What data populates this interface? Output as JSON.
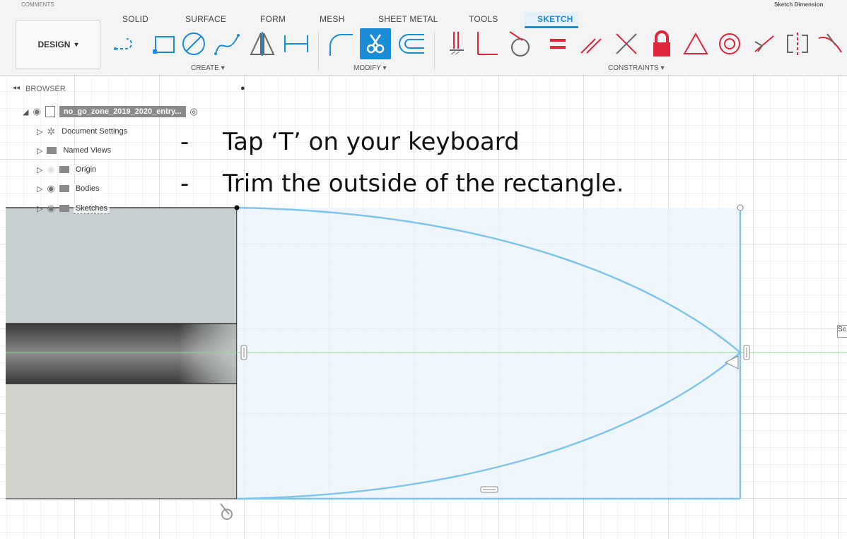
{
  "header": {
    "comments_label": "COMMENTS",
    "sketch_dimension_label": "Sketch Dimension"
  },
  "tabs": [
    "SOLID",
    "SURFACE",
    "FORM",
    "MESH",
    "SHEET METAL",
    "TOOLS",
    "SKETCH"
  ],
  "active_tab": "SKETCH",
  "workspace": {
    "label": "DESIGN",
    "caret": "▾"
  },
  "groups": {
    "create": "CREATE ▾",
    "modify": "MODIFY ▾",
    "constraints": "CONSTRAINTS ▾"
  },
  "browser": {
    "title": "BROWSER",
    "root": "no_go_zone_2019_2020_entry...",
    "items": [
      "Document Settings",
      "Named Views",
      "Origin",
      "Bodies",
      "Sketches"
    ]
  },
  "instructions": [
    {
      "bullet": "-",
      "text": "Tap ‘T’ on your keyboard"
    },
    {
      "bullet": "-",
      "text": "Trim the outside of the rectangle."
    }
  ],
  "side_tag": "Sc",
  "colors": {
    "accent": "#1a8cd8",
    "constraint_red": "#e0263a",
    "sketch_line": "#7fc4ea",
    "sketch_fill": "#e9f4fb",
    "axis_green": "#8fd48f"
  }
}
